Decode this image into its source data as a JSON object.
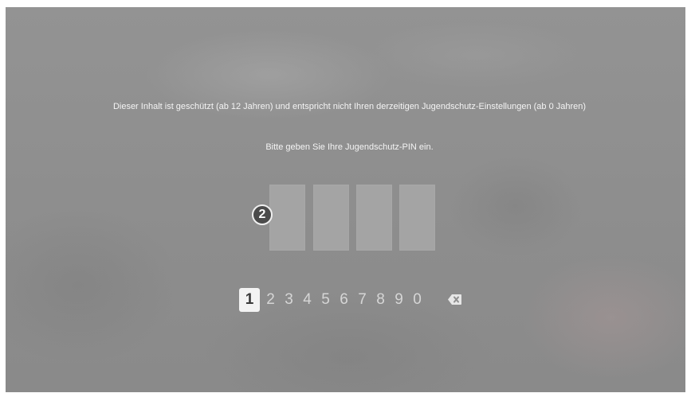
{
  "parental_control": {
    "message": "Dieser Inhalt ist geschützt (ab 12 Jahren) und entspricht nicht Ihren derzeitigen Jugendschutz-Einstellungen (ab 0 Jahren)",
    "prompt": "Bitte geben Sie Ihre Jugendschutz-PIN ein.",
    "pin_slots": [
      "",
      "",
      "",
      ""
    ],
    "step_badge": "2"
  },
  "keypad": {
    "digits": [
      "1",
      "2",
      "3",
      "4",
      "5",
      "6",
      "7",
      "8",
      "9",
      "0"
    ],
    "selected_digit": "1",
    "delete_icon": "backspace-icon"
  }
}
